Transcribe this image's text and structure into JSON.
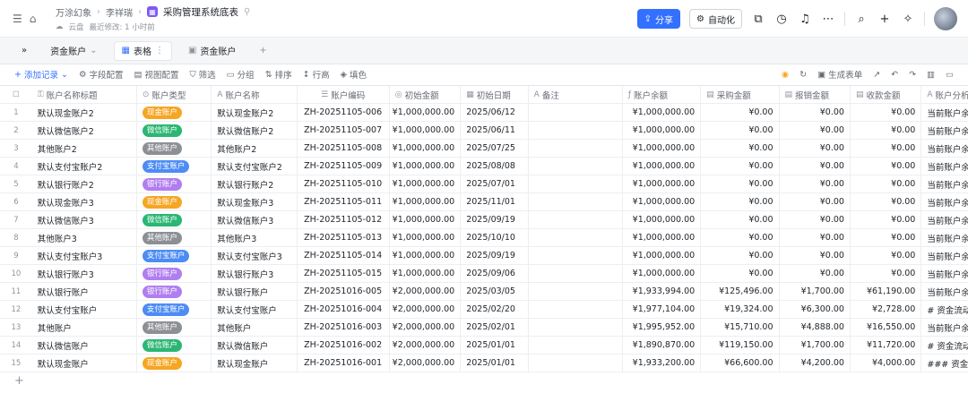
{
  "header": {
    "crumbs": [
      "万涂幻象",
      "李祥瑞"
    ],
    "doc_title": "采购管理系统底表",
    "location": "云盘",
    "last_modified": "最近修改: 1 小时前",
    "share_label": "分享",
    "automation_label": "自动化"
  },
  "tabs": {
    "current": "资金账户",
    "view_label": "表格",
    "form_label": "资金账户"
  },
  "toolbar": {
    "add_record": "添加记录",
    "field_config": "字段配置",
    "view_config": "视图配置",
    "filter": "筛选",
    "group": "分组",
    "sort": "排序",
    "row_height": "行高",
    "fill_color": "填色",
    "generate_form": "生成表单"
  },
  "columns": [
    "账户名称标题",
    "账户类型",
    "账户名称",
    "账户编码",
    "初始金额",
    "初始日期",
    "备注",
    "账户余额",
    "采购金额",
    "报销金额",
    "收款金额",
    "账户分析"
  ],
  "type_colors": {
    "现金账户": "#f5a623",
    "微信账户": "#2bb673",
    "其他账户": "#8c8f94",
    "支付宝账户": "#4d8cf5",
    "银行账户": "#b07ef0"
  },
  "rows": [
    {
      "idx": "1",
      "name": "默认现金账户2",
      "type": "现金账户",
      "acc": "默认现金账户2",
      "code": "ZH-20251105-006",
      "init": "¥1,000,000.00",
      "date": "2025/06/12",
      "note": "",
      "bal": "¥1,000,000.00",
      "pur": "¥0.00",
      "exp": "¥0.00",
      "rec": "¥0.00",
      "ana": "当前账户余额"
    },
    {
      "idx": "2",
      "name": "默认微信账户2",
      "type": "微信账户",
      "acc": "默认微信账户2",
      "code": "ZH-20251105-007",
      "init": "¥1,000,000.00",
      "date": "2025/06/11",
      "note": "",
      "bal": "¥1,000,000.00",
      "pur": "¥0.00",
      "exp": "¥0.00",
      "rec": "¥0.00",
      "ana": "当前账户余额"
    },
    {
      "idx": "3",
      "name": "其他账户2",
      "type": "其他账户",
      "acc": "其他账户2",
      "code": "ZH-20251105-008",
      "init": "¥1,000,000.00",
      "date": "2025/07/25",
      "note": "",
      "bal": "¥1,000,000.00",
      "pur": "¥0.00",
      "exp": "¥0.00",
      "rec": "¥0.00",
      "ana": "当前账户余额"
    },
    {
      "idx": "4",
      "name": "默认支付宝账户2",
      "type": "支付宝账户",
      "acc": "默认支付宝账户2",
      "code": "ZH-20251105-009",
      "init": "¥1,000,000.00",
      "date": "2025/08/08",
      "note": "",
      "bal": "¥1,000,000.00",
      "pur": "¥0.00",
      "exp": "¥0.00",
      "rec": "¥0.00",
      "ana": "当前账户余额"
    },
    {
      "idx": "5",
      "name": "默认银行账户2",
      "type": "银行账户",
      "acc": "默认银行账户2",
      "code": "ZH-20251105-010",
      "init": "¥1,000,000.00",
      "date": "2025/07/01",
      "note": "",
      "bal": "¥1,000,000.00",
      "pur": "¥0.00",
      "exp": "¥0.00",
      "rec": "¥0.00",
      "ana": "当前账户余额"
    },
    {
      "idx": "6",
      "name": "默认现金账户3",
      "type": "现金账户",
      "acc": "默认现金账户3",
      "code": "ZH-20251105-011",
      "init": "¥1,000,000.00",
      "date": "2025/11/01",
      "note": "",
      "bal": "¥1,000,000.00",
      "pur": "¥0.00",
      "exp": "¥0.00",
      "rec": "¥0.00",
      "ana": "当前账户余额"
    },
    {
      "idx": "7",
      "name": "默认微信账户3",
      "type": "微信账户",
      "acc": "默认微信账户3",
      "code": "ZH-20251105-012",
      "init": "¥1,000,000.00",
      "date": "2025/09/19",
      "note": "",
      "bal": "¥1,000,000.00",
      "pur": "¥0.00",
      "exp": "¥0.00",
      "rec": "¥0.00",
      "ana": "当前账户余额"
    },
    {
      "idx": "8",
      "name": "其他账户3",
      "type": "其他账户",
      "acc": "其他账户3",
      "code": "ZH-20251105-013",
      "init": "¥1,000,000.00",
      "date": "2025/10/10",
      "note": "",
      "bal": "¥1,000,000.00",
      "pur": "¥0.00",
      "exp": "¥0.00",
      "rec": "¥0.00",
      "ana": "当前账户余额"
    },
    {
      "idx": "9",
      "name": "默认支付宝账户3",
      "type": "支付宝账户",
      "acc": "默认支付宝账户3",
      "code": "ZH-20251105-014",
      "init": "¥1,000,000.00",
      "date": "2025/09/19",
      "note": "",
      "bal": "¥1,000,000.00",
      "pur": "¥0.00",
      "exp": "¥0.00",
      "rec": "¥0.00",
      "ana": "当前账户余额"
    },
    {
      "idx": "10",
      "name": "默认银行账户3",
      "type": "银行账户",
      "acc": "默认银行账户3",
      "code": "ZH-20251105-015",
      "init": "¥1,000,000.00",
      "date": "2025/09/06",
      "note": "",
      "bal": "¥1,000,000.00",
      "pur": "¥0.00",
      "exp": "¥0.00",
      "rec": "¥0.00",
      "ana": "当前账户余额"
    },
    {
      "idx": "11",
      "name": "默认银行账户",
      "type": "银行账户",
      "acc": "默认银行账户",
      "code": "ZH-20251016-005",
      "init": "¥2,000,000.00",
      "date": "2025/03/05",
      "note": "",
      "bal": "¥1,933,994.00",
      "pur": "¥125,496.00",
      "exp": "¥1,700.00",
      "rec": "¥61,190.00",
      "ana": "当前账户余额"
    },
    {
      "idx": "12",
      "name": "默认支付宝账户",
      "type": "支付宝账户",
      "acc": "默认支付宝账户",
      "code": "ZH-20251016-004",
      "init": "¥2,000,000.00",
      "date": "2025/02/20",
      "note": "",
      "bal": "¥1,977,104.00",
      "pur": "¥19,324.00",
      "exp": "¥6,300.00",
      "rec": "¥2,728.00",
      "ana": "# 资金流动报"
    },
    {
      "idx": "13",
      "name": "其他账户",
      "type": "其他账户",
      "acc": "其他账户",
      "code": "ZH-20251016-003",
      "init": "¥2,000,000.00",
      "date": "2025/02/01",
      "note": "",
      "bal": "¥1,995,952.00",
      "pur": "¥15,710.00",
      "exp": "¥4,888.00",
      "rec": "¥16,550.00",
      "ana": "当前账户余额"
    },
    {
      "idx": "14",
      "name": "默认微信账户",
      "type": "微信账户",
      "acc": "默认微信账户",
      "code": "ZH-20251016-002",
      "init": "¥2,000,000.00",
      "date": "2025/01/01",
      "note": "",
      "bal": "¥1,890,870.00",
      "pur": "¥119,150.00",
      "exp": "¥1,700.00",
      "rec": "¥11,720.00",
      "ana": "# 资金流动报"
    },
    {
      "idx": "15",
      "name": "默认现金账户",
      "type": "现金账户",
      "acc": "默认现金账户",
      "code": "ZH-20251016-001",
      "init": "¥2,000,000.00",
      "date": "2025/01/01",
      "note": "",
      "bal": "¥1,933,200.00",
      "pur": "¥66,600.00",
      "exp": "¥4,200.00",
      "rec": "¥4,000.00",
      "ana": "### 资金流动"
    }
  ]
}
